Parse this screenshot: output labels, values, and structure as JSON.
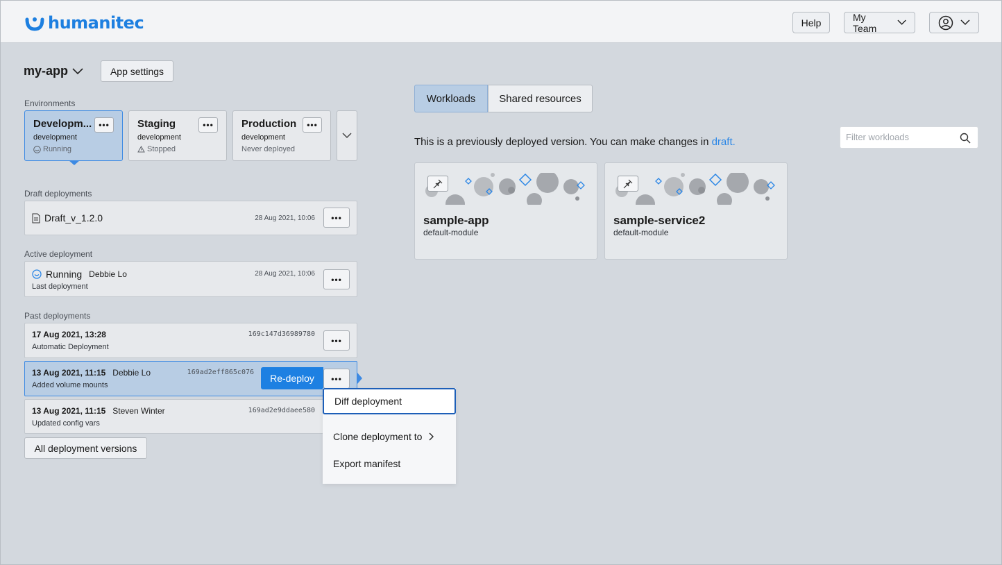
{
  "header": {
    "brand": "humanitec",
    "help_label": "Help",
    "team_label": "My Team"
  },
  "app": {
    "name": "my-app",
    "settings_label": "App settings"
  },
  "environments": {
    "label": "Environments",
    "items": [
      {
        "name": "Developm...",
        "type": "development",
        "status": "Running"
      },
      {
        "name": "Staging",
        "type": "development",
        "status": "Stopped"
      },
      {
        "name": "Production",
        "type": "development",
        "status": "Never deployed"
      }
    ]
  },
  "draft": {
    "label": "Draft deployments",
    "name": "Draft_v_1.2.0",
    "date": "28 Aug 2021, 10:06"
  },
  "active": {
    "label": "Active deployment",
    "status": "Running",
    "user": "Debbie Lo",
    "note": "Last deployment",
    "date": "28 Aug 2021, 10:06"
  },
  "past": {
    "label": "Past deployments",
    "rows": [
      {
        "date": "17 Aug 2021, 13:28",
        "user": "",
        "note": "Automatic Deployment",
        "hash": "169c147d36989780"
      },
      {
        "date": "13 Aug 2021, 11:15",
        "user": "Debbie Lo",
        "note": "Added volume mounts",
        "hash": "169ad2eff865c076"
      },
      {
        "date": "13 Aug 2021, 11:15",
        "user": "Steven Winter",
        "note": "Updated config vars",
        "hash": "169ad2e9ddaee580"
      }
    ],
    "redeploy_label": "Re-deploy",
    "all_versions_label": "All deployment versions"
  },
  "menu": {
    "items": [
      "Diff deployment",
      "Clone deployment to",
      "Export manifest"
    ]
  },
  "right": {
    "tabs": [
      "Workloads",
      "Shared resources"
    ],
    "notice": "This is a previously deployed version. You can make changes in",
    "notice_link": "draft.",
    "filter_placeholder": "Filter workloads",
    "workloads": [
      {
        "name": "sample-app",
        "module": "default-module"
      },
      {
        "name": "sample-service2",
        "module": "default-module"
      }
    ]
  },
  "colors": {
    "accent": "#1d80e2",
    "selected_bg": "#b8cde4",
    "page_bg": "#d3d8de"
  }
}
